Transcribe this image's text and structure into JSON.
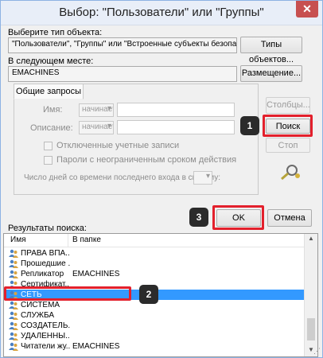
{
  "window": {
    "title": "Выбор: \"Пользователи\" или \"Группы\"",
    "close_glyph": "✕"
  },
  "object_type": {
    "label": "Выберите тип объекта:",
    "value": "\"Пользователи\", \"Группы\" или \"Встроенные субъекты безопасности\"",
    "button": "Типы объектов..."
  },
  "location": {
    "label": "В следующем месте:",
    "value": "EMACHINES",
    "button": "Размещение..."
  },
  "queries": {
    "tab": "Общие запросы",
    "name_label": "Имя:",
    "name_mode": "начинается с",
    "desc_label": "Описание:",
    "desc_mode": "начинается с",
    "disabled_accounts": "Отключенные учетные записи",
    "non_expiring": "Пароли с неограниченным сроком действия",
    "days_label": "Число дней со времени последнего входа в систему:"
  },
  "buttons": {
    "columns": "Столбцы...",
    "search": "Поиск",
    "stop": "Стоп",
    "ok": "OK",
    "cancel": "Отмена"
  },
  "results": {
    "label": "Результаты поиска:",
    "col_name": "Имя",
    "col_folder": "В папке",
    "rows": [
      {
        "name": "ПРАВА ВПА...",
        "folder": ""
      },
      {
        "name": "Прошедшие ...",
        "folder": ""
      },
      {
        "name": "Репликатор",
        "folder": "EMACHINES"
      },
      {
        "name": "Сертификат...",
        "folder": ""
      },
      {
        "name": "СЕТЬ",
        "folder": ""
      },
      {
        "name": "СИСТЕМА",
        "folder": ""
      },
      {
        "name": "СЛУЖБА",
        "folder": ""
      },
      {
        "name": "СОЗДАТЕЛЬ...",
        "folder": ""
      },
      {
        "name": "УДАЛЕННЫ...",
        "folder": ""
      },
      {
        "name": "Читатели жу...",
        "folder": "EMACHINES"
      }
    ],
    "selected_index": 4
  },
  "markers": {
    "m1": "1",
    "m2": "2",
    "m3": "3"
  },
  "colors": {
    "highlight": "#e3202c",
    "selection": "#3399ff",
    "marker": "#2b2b2b"
  }
}
